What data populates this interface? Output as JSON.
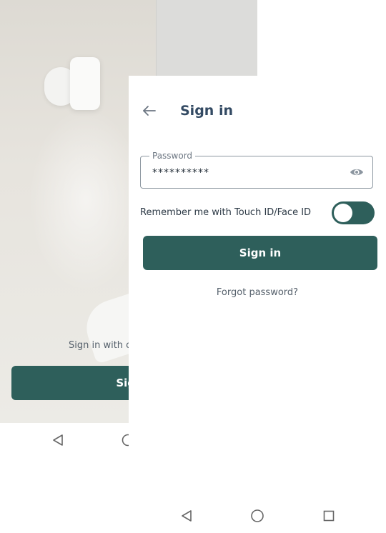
{
  "background": {
    "hint_text": "Sign in with o",
    "signin_button_label": "Sign"
  },
  "sheet": {
    "title": "Sign in",
    "password": {
      "label": "Password",
      "value": "**********"
    },
    "remember_label": "Remember me with Touch ID/Face ID",
    "remember_enabled": true,
    "signin_button_label": "Sign in",
    "forgot_password_label": "Forgot password?"
  },
  "icons": {
    "back": "arrow-left-icon",
    "password_visibility": "eye-icon",
    "nav_back": "nav-back-icon",
    "nav_home": "nav-home-icon",
    "nav_recent": "nav-recent-icon"
  },
  "colors": {
    "primary": "#2e5f5b",
    "title": "#334a63",
    "text": "#2c3945",
    "muted": "#55606b"
  }
}
